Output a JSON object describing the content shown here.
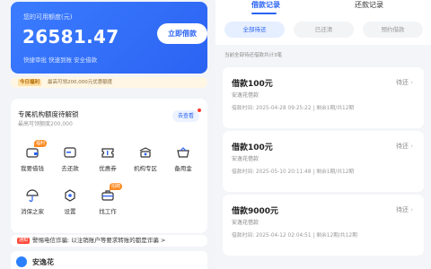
{
  "left": {
    "card": {
      "label": "您的可用额度(元)",
      "amount": "26581.47",
      "features": "快捷审批  快速到账  安全借款",
      "borrow_button": "立即借款"
    },
    "gold_bar": {
      "tag": "今日福利",
      "text": "最高可领200,000元优惠额度"
    },
    "unlock": {
      "title": "专属机构额度待解锁",
      "subtitle": "最高可领额度200,000",
      "button": "去查看"
    },
    "grid": [
      {
        "label": "我要借钱",
        "icon": "wallet-icon",
        "badge": "福利"
      },
      {
        "label": "去还款",
        "icon": "card-icon",
        "badge": ""
      },
      {
        "label": "优惠券",
        "icon": "coupon-icon",
        "badge": ""
      },
      {
        "label": "机构专区",
        "icon": "bank-icon",
        "badge": ""
      },
      {
        "label": "备用金",
        "icon": "basket-icon",
        "badge": ""
      },
      {
        "label": "消保之家",
        "icon": "umbrella-icon",
        "badge": ""
      },
      {
        "label": "设置",
        "icon": "gear-icon",
        "badge": ""
      },
      {
        "label": "找工作",
        "icon": "briefcase-icon",
        "badge": "招聘"
      }
    ],
    "notice": {
      "tag": "通知",
      "text": "警惕电信诈骗: 以注销账户等要求转账的都是诈骗 >"
    },
    "bottom": {
      "name": "安逸花"
    }
  },
  "right": {
    "tabs": [
      "借款记录",
      "还款记录"
    ],
    "filters": [
      "全部待还",
      "已还清",
      "预约借款"
    ],
    "count_text": "当前全部待还借款共计3笔",
    "loans": [
      {
        "amount": "借款100元",
        "status": "待还",
        "name": "安逸花借款",
        "time": "借款时间: 2025-04-28 09:25:22  |  剩余1期/共12期"
      },
      {
        "amount": "借款100元",
        "status": "待还",
        "name": "安逸花借款",
        "time": "借款时间: 2025-05-10 20:11:48  |  剩余1期/共12期"
      },
      {
        "amount": "借款9000元",
        "status": "待还",
        "name": "安逸花借款",
        "time": "借款时间: 2025-04-12 02:04:51  |  剩余12期/共12期"
      }
    ]
  },
  "colors": {
    "primary": "#2b63f2",
    "badge": "#ff8a1f",
    "alert": "#ff4a3a"
  }
}
